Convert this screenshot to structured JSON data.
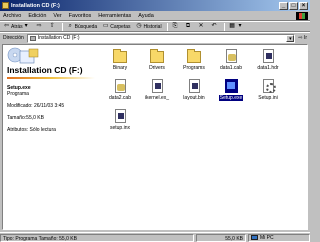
{
  "window": {
    "title": "Installation CD (F:)",
    "buttons": [
      "_",
      "□",
      "×"
    ]
  },
  "menubar": {
    "items": [
      "Archivo",
      "Edición",
      "Ver",
      "Favoritos",
      "Herramientas",
      "Ayuda"
    ]
  },
  "toolbar": {
    "back": "Atrás",
    "search": "Búsqueda",
    "folders": "Carpetas",
    "history": "Historial"
  },
  "address": {
    "label": "Dirección",
    "value": "Installation CD (F:)",
    "go": "Ir"
  },
  "left_panel": {
    "title": "Installation CD (F:)",
    "selected_name": "Setup.exe",
    "selected_type": "Programa",
    "modified": "Modificado: 26/11/03 3:45",
    "size": "Tamaño:55,0 KB",
    "attributes": "Atributos: Sólo lectura"
  },
  "files": [
    {
      "name": "Binary",
      "type": "folder"
    },
    {
      "name": "Drivers",
      "type": "folder"
    },
    {
      "name": "Programs",
      "type": "folder"
    },
    {
      "name": "data1.cab",
      "type": "cab"
    },
    {
      "name": "data1.hdr",
      "type": "doc"
    },
    {
      "name": "data2.cab",
      "type": "cab"
    },
    {
      "name": "ikernel.ex_",
      "type": "doc"
    },
    {
      "name": "layout.bin",
      "type": "doc"
    },
    {
      "name": "Setup.exe",
      "type": "exe",
      "selected": true
    },
    {
      "name": "Setup.ini",
      "type": "gear"
    },
    {
      "name": "setup.inx",
      "type": "doc"
    }
  ],
  "statusbar": {
    "text": "Tipo: Programa Tamaño: 55,0 KB",
    "size": "55,0 KB",
    "zone": "Mi PC"
  }
}
